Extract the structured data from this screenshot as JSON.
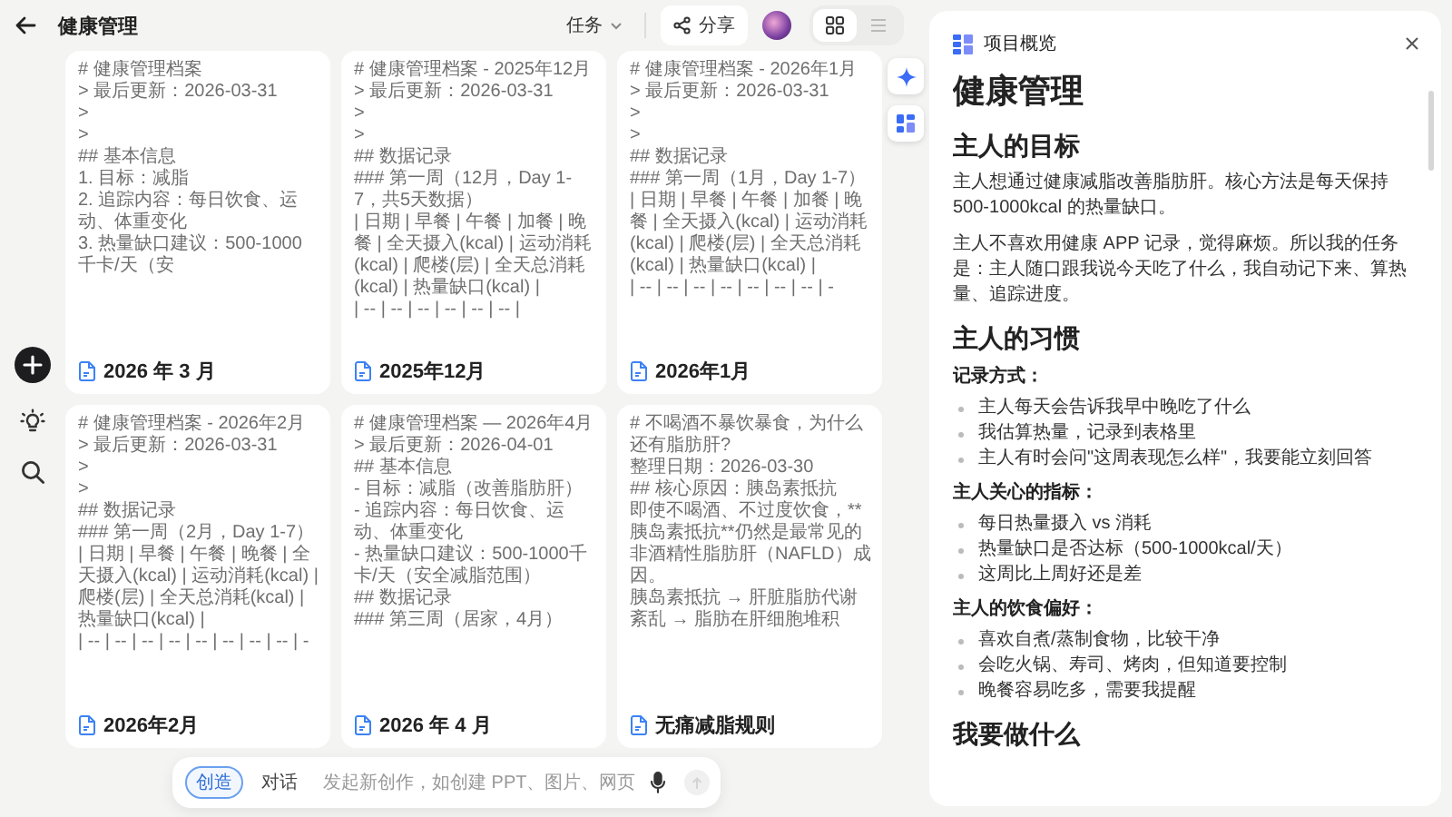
{
  "header": {
    "title": "健康管理",
    "task_menu": "任务",
    "share": "分享",
    "views": [
      {
        "kind": "grid",
        "selected": true
      },
      {
        "kind": "list",
        "selected": false
      }
    ]
  },
  "cards": [
    {
      "preview": [
        "# 健康管理档案",
        "> 最后更新：2026-03-31",
        ">",
        ">",
        "## 基本信息",
        "1. 目标：减脂",
        "2. 追踪内容：每日饮食、运动、体重变化",
        "3. 热量缺口建议：500-1000千卡/天（安"
      ],
      "title": "2026 年 3 月"
    },
    {
      "preview": [
        "# 健康管理档案 - 2025年12月",
        "> 最后更新：2026-03-31",
        ">",
        ">",
        "## 数据记录",
        "### 第一周（12月，Day 1-7，共5天数据）",
        "| 日期 | 早餐 | 午餐 | 加餐 | 晚餐 | 全天摄入(kcal) | 运动消耗(kcal) | 爬楼(层) | 全天总消耗(kcal) | 热量缺口(kcal) |",
        "| -- | -- | -- | -- | -- | -- |"
      ],
      "title": "2025年12月"
    },
    {
      "preview": [
        "# 健康管理档案 - 2026年1月",
        "> 最后更新：2026-03-31",
        ">",
        ">",
        "## 数据记录",
        "### 第一周（1月，Day 1-7）",
        "| 日期 | 早餐 | 午餐 | 加餐 | 晚餐 | 全天摄入(kcal) | 运动消耗(kcal) | 爬楼(层) | 全天总消耗(kcal) | 热量缺口(kcal) |",
        "| -- | -- | -- | -- | -- | -- | -- | -"
      ],
      "title": "2026年1月"
    },
    {
      "preview": [
        "# 健康管理档案 - 2026年2月",
        "> 最后更新：2026-03-31",
        ">",
        ">",
        "## 数据记录",
        "### 第一周（2月，Day 1-7）",
        "| 日期 | 早餐 | 午餐 | 晚餐 | 全天摄入(kcal) | 运动消耗(kcal) | 爬楼(层) | 全天总消耗(kcal) | 热量缺口(kcal) |",
        "| -- | -- | -- | -- | -- | -- | -- | -- | -"
      ],
      "title": "2026年2月"
    },
    {
      "preview": [
        "# 健康管理档案 — 2026年4月",
        "> 最后更新：2026-04-01",
        "## 基本信息",
        "- 目标：减脂（改善脂肪肝）",
        "- 追踪内容：每日饮食、运动、体重变化",
        "- 热量缺口建议：500-1000千卡/天（安全减脂范围）",
        "## 数据记录",
        "### 第三周（居家，4月）"
      ],
      "title": "2026 年 4 月"
    },
    {
      "preview": [
        "# 不喝酒不暴饮暴食，为什么还有脂肪肝?",
        "整理日期：2026-03-30",
        "## 核心原因：胰岛素抵抗",
        "即使不喝酒、不过度饮食，**胰岛素抵抗**仍然是最常见的非酒精性脂肪肝（NAFLD）成因。",
        "胰岛素抵抗 → 肝脏脂肪代谢紊乱 → 脂肪在肝细胞堆积"
      ],
      "title": "无痛减脂规则"
    }
  ],
  "composer": {
    "modes": [
      {
        "label": "创造",
        "selected": true
      },
      {
        "label": "对话",
        "selected": false
      }
    ],
    "placeholder": "发起新创作，如创建 PPT、图片、网页"
  },
  "overview": {
    "title": "项目概览",
    "blocks": [
      {
        "kind": "heading",
        "text": "健康管理"
      },
      {
        "kind": "section",
        "text": "主人的目标"
      },
      {
        "kind": "paragraph",
        "text": "主人想通过健康减脂改善脂肪肝。核心方法是每天保持 500-1000kcal 的热量缺口。"
      },
      {
        "kind": "paragraph",
        "text": "主人不喜欢用健康 APP 记录，觉得麻烦。所以我的任务是：主人随口跟我说今天吃了什么，我自动记下来、算热量、追踪进度。"
      },
      {
        "kind": "section",
        "text": "主人的习惯"
      },
      {
        "kind": "label",
        "text": "记录方式："
      },
      {
        "kind": "list",
        "items": [
          "主人每天会告诉我早中晚吃了什么",
          "我估算热量，记录到表格里",
          "主人有时会问\"这周表现怎么样\"，我要能立刻回答"
        ]
      },
      {
        "kind": "label",
        "text": "主人关心的指标："
      },
      {
        "kind": "list",
        "items": [
          "每日热量摄入 vs 消耗",
          "热量缺口是否达标（500-1000kcal/天）",
          "这周比上周好还是差"
        ]
      },
      {
        "kind": "label",
        "text": "主人的饮食偏好："
      },
      {
        "kind": "list",
        "items": [
          "喜欢自煮/蒸制食物，比较干净",
          "会吃火锅、寿司、烤肉，但知道要控制",
          "晚餐容易吃多，需要我提醒"
        ]
      },
      {
        "kind": "section",
        "text": "我要做什么"
      }
    ]
  }
}
